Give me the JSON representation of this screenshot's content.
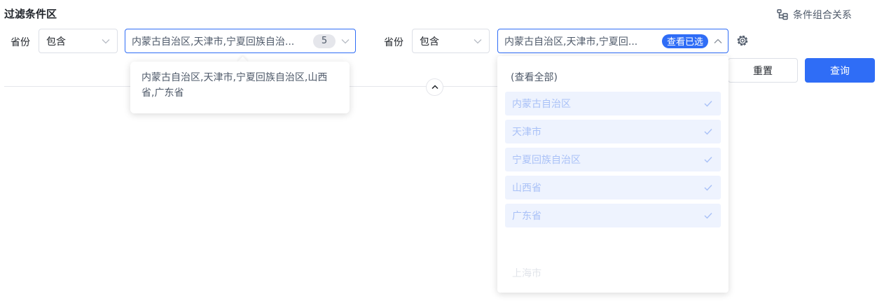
{
  "section_title": "过滤条件区",
  "combo_link": {
    "label": "条件组合关系",
    "icon": "flow-branch-icon"
  },
  "filters": [
    {
      "field_label": "省份",
      "operator": "包含",
      "value_text": "内蒙古自治区,天津市,宁夏回族自治...",
      "count": "5"
    },
    {
      "field_label": "省份",
      "operator": "包含",
      "value_text": "内蒙古自治区,天津市,宁夏回...",
      "view_selected_label": "查看已选"
    }
  ],
  "tooltip": {
    "text": "内蒙古自治区,天津市,宁夏回族自治区,山西省,广东省"
  },
  "dropdown": {
    "view_all": "(查看全部)",
    "items": [
      {
        "label": "内蒙古自治区",
        "checked": true
      },
      {
        "label": "天津市",
        "checked": true
      },
      {
        "label": "宁夏回族自治区",
        "checked": true
      },
      {
        "label": "山西省",
        "checked": true
      },
      {
        "label": "广东省",
        "checked": true
      }
    ],
    "faded_item": "上海市"
  },
  "buttons": {
    "reset": "重置",
    "query": "查询"
  },
  "colors": {
    "primary": "#2f6df6",
    "selected_bg": "#eef3fe",
    "selected_text": "#a9c1f7"
  }
}
